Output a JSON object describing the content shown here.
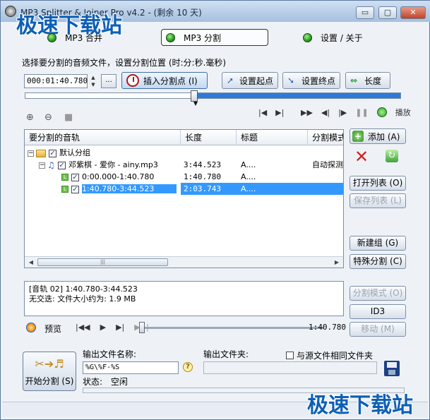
{
  "window": {
    "title": "MP3 Splitter & Joiner Pro v4.2 - (剩余 10 天)",
    "controls": {
      "minimize": "▭",
      "maximize": "▢",
      "close": "✕"
    }
  },
  "watermark": {
    "text": "极速下载站"
  },
  "modes": [
    {
      "label": "MP3 合并"
    },
    {
      "label": "MP3 分割"
    },
    {
      "label": "设置 / 关于"
    }
  ],
  "split": {
    "hint": "选择要分割的音频文件，设置分割位置 (时:分:秒.毫秒)",
    "time_value": "000:01:40.780",
    "browse_label": "...",
    "insert_label": "插入分割点 (I)",
    "start_label": "设置起点",
    "end_label": "设置终点",
    "length_label": "长度",
    "position_fraction": 0.45,
    "play_label": "播放"
  },
  "table": {
    "columns": [
      "要分割的音轨",
      "长度",
      "标题",
      "分割模式"
    ],
    "rows": [
      {
        "indent": 0,
        "expander": "−",
        "checked": true,
        "icon": "folder-icon",
        "track": "默认分组",
        "length": "",
        "title": "",
        "mode": ""
      },
      {
        "indent": 1,
        "expander": "−",
        "checked": true,
        "icon": "music-icon",
        "track": "邓紫棋 - 爱你 - ainy.mp3",
        "length": "3:44.523",
        "title": "A....",
        "mode": "自动探测"
      },
      {
        "indent": 2,
        "expander": "",
        "checked": true,
        "icon": "segment-icon",
        "track": "0:00.000-1:40.780",
        "length": "1:40.780",
        "title": "A....",
        "mode": ""
      },
      {
        "indent": 2,
        "expander": "",
        "checked": true,
        "icon": "segment-icon",
        "track": "1:40.780-3:44.523",
        "length": "2:03.743",
        "title": "A....",
        "mode": "",
        "selected": true
      }
    ]
  },
  "side_buttons": {
    "add": "添加 (A)",
    "open_list": "打开列表 (O)",
    "save_list": "保存列表 (L)",
    "new_group": "新建组 (G)",
    "special_split": "特殊分割 (C)",
    "split_mode": "分割模式 (O)",
    "id3": "ID3",
    "move": "移动 (M)"
  },
  "info": {
    "line1": "[音轨 02] 1:40.780-3:44.523",
    "line2": "无交迭: 文件大小约为: 1.9 MB"
  },
  "preview": {
    "label": "预览",
    "time": "1:40.780"
  },
  "output": {
    "start_label": "开始分割 (S)",
    "name_label": "输出文件名称:",
    "name_value": "%G\\%F-%S",
    "folder_label": "输出文件夹:",
    "same_folder_label": "与源文件相同文件夹",
    "status_label": "状态:",
    "status_value": "空闲"
  }
}
